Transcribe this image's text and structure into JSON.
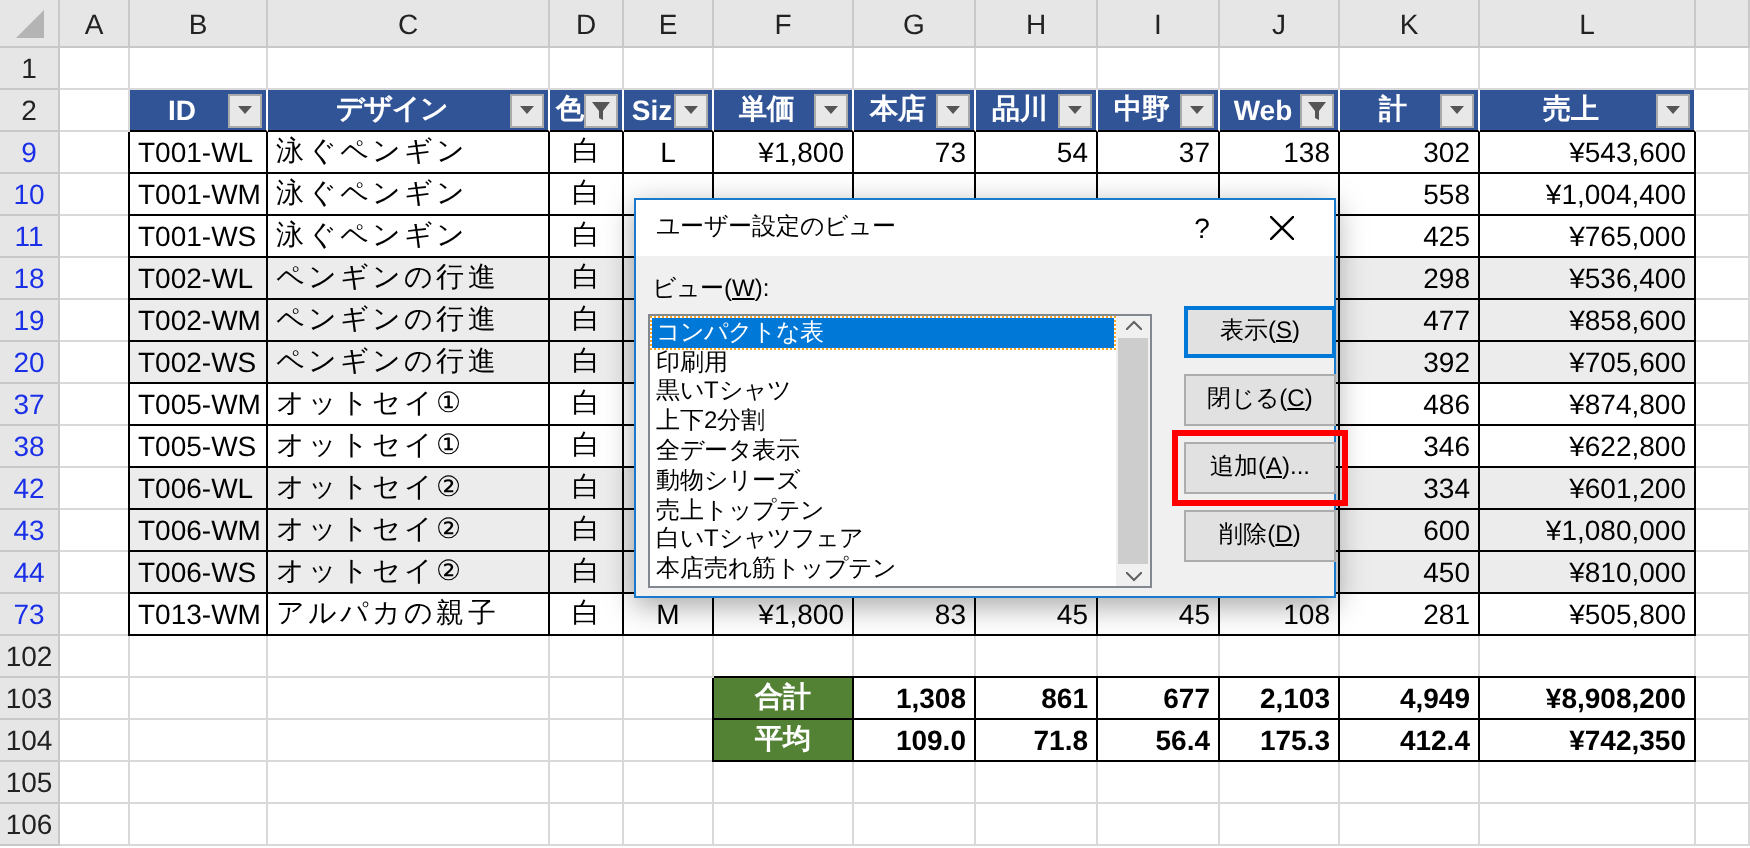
{
  "columns": [
    "A",
    "B",
    "C",
    "D",
    "E",
    "F",
    "G",
    "H",
    "I",
    "J",
    "K",
    "L"
  ],
  "rows": [
    {
      "num": "1",
      "kind": "blank",
      "filtered": false
    },
    {
      "num": "2",
      "kind": "header",
      "filtered": false,
      "headers": [
        {
          "label": "ID",
          "filtered": false
        },
        {
          "label": "デザイン",
          "filtered": false
        },
        {
          "label": "色",
          "filtered": true
        },
        {
          "label": "Siz",
          "filtered": false
        },
        {
          "label": "単価",
          "filtered": false
        },
        {
          "label": "本店",
          "filtered": false
        },
        {
          "label": "品川",
          "filtered": false
        },
        {
          "label": "中野",
          "filtered": false
        },
        {
          "label": "Web",
          "filtered": true
        },
        {
          "label": "計",
          "filtered": false
        },
        {
          "label": "売上",
          "filtered": false
        }
      ]
    },
    {
      "num": "9",
      "kind": "data",
      "filtered": true,
      "shaded": false,
      "cells": [
        "T001-WL",
        "泳ぐペンギン",
        "白",
        "L",
        "¥1,800",
        "73",
        "54",
        "37",
        "138",
        "302",
        "¥543,600"
      ]
    },
    {
      "num": "10",
      "kind": "data",
      "filtered": true,
      "shaded": false,
      "cells": [
        "T001-WM",
        "泳ぐペンギン",
        "白",
        null,
        null,
        null,
        null,
        null,
        null,
        "558",
        "¥1,004,400"
      ]
    },
    {
      "num": "11",
      "kind": "data",
      "filtered": true,
      "shaded": false,
      "cells": [
        "T001-WS",
        "泳ぐペンギン",
        "白",
        null,
        null,
        null,
        null,
        null,
        null,
        "425",
        "¥765,000"
      ]
    },
    {
      "num": "18",
      "kind": "data",
      "filtered": true,
      "shaded": true,
      "cells": [
        "T002-WL",
        "ペンギンの行進",
        "白",
        null,
        null,
        null,
        null,
        null,
        null,
        "298",
        "¥536,400"
      ]
    },
    {
      "num": "19",
      "kind": "data",
      "filtered": true,
      "shaded": true,
      "cells": [
        "T002-WM",
        "ペンギンの行進",
        "白",
        null,
        null,
        null,
        null,
        null,
        null,
        "477",
        "¥858,600"
      ]
    },
    {
      "num": "20",
      "kind": "data",
      "filtered": true,
      "shaded": true,
      "cells": [
        "T002-WS",
        "ペンギンの行進",
        "白",
        null,
        null,
        null,
        null,
        null,
        null,
        "392",
        "¥705,600"
      ]
    },
    {
      "num": "37",
      "kind": "data",
      "filtered": true,
      "shaded": false,
      "cells": [
        "T005-WM",
        "オットセイ①",
        "白",
        null,
        null,
        null,
        null,
        null,
        null,
        "486",
        "¥874,800"
      ]
    },
    {
      "num": "38",
      "kind": "data",
      "filtered": true,
      "shaded": false,
      "cells": [
        "T005-WS",
        "オットセイ①",
        "白",
        null,
        null,
        null,
        null,
        null,
        null,
        "346",
        "¥622,800"
      ]
    },
    {
      "num": "42",
      "kind": "data",
      "filtered": true,
      "shaded": true,
      "cells": [
        "T006-WL",
        "オットセイ②",
        "白",
        null,
        null,
        null,
        null,
        null,
        null,
        "334",
        "¥601,200"
      ]
    },
    {
      "num": "43",
      "kind": "data",
      "filtered": true,
      "shaded": true,
      "cells": [
        "T006-WM",
        "オットセイ②",
        "白",
        null,
        null,
        null,
        null,
        null,
        null,
        "600",
        "¥1,080,000"
      ]
    },
    {
      "num": "44",
      "kind": "data",
      "filtered": true,
      "shaded": true,
      "cells": [
        "T006-WS",
        "オットセイ②",
        "白",
        null,
        null,
        null,
        null,
        null,
        null,
        "450",
        "¥810,000"
      ]
    },
    {
      "num": "73",
      "kind": "data",
      "filtered": true,
      "shaded": false,
      "cells": [
        "T013-WM",
        "アルパカの親子",
        "白",
        "M",
        "¥1,800",
        "83",
        "45",
        "45",
        "108",
        "281",
        "¥505,800"
      ]
    },
    {
      "num": "102",
      "kind": "blank",
      "filtered": false
    },
    {
      "num": "103",
      "kind": "total",
      "filtered": false,
      "label": "合計",
      "values": [
        "1,308",
        "861",
        "677",
        "2,103",
        "4,949",
        "¥8,908,200"
      ]
    },
    {
      "num": "104",
      "kind": "total",
      "filtered": false,
      "label": "平均",
      "values": [
        "109.0",
        "71.8",
        "56.4",
        "175.3",
        "412.4",
        "¥742,350"
      ]
    },
    {
      "num": "105",
      "kind": "blank",
      "filtered": false
    },
    {
      "num": "106",
      "kind": "blank",
      "filtered": false
    }
  ],
  "dialog": {
    "title": "ユーザー設定のビュー",
    "help": "?",
    "list_label": {
      "before": "ビュー(",
      "mnemonic": "W",
      "after": "):"
    },
    "views": [
      {
        "label": "コンパクトな表",
        "selected": true
      },
      {
        "label": "印刷用",
        "selected": false
      },
      {
        "label": "黒いTシャツ",
        "selected": false
      },
      {
        "label": "上下2分割",
        "selected": false
      },
      {
        "label": "全データ表示",
        "selected": false
      },
      {
        "label": "動物シリーズ",
        "selected": false
      },
      {
        "label": "売上トップテン",
        "selected": false
      },
      {
        "label": "白いTシャツフェア",
        "selected": false
      },
      {
        "label": "本店売れ筋トップテン",
        "selected": false
      }
    ],
    "buttons": [
      {
        "before": "表示(",
        "mnemonic": "S",
        "after": ")",
        "default": true,
        "highlighted": false
      },
      {
        "before": "閉じる(",
        "mnemonic": "C",
        "after": ")",
        "default": false,
        "highlighted": false
      },
      {
        "before": "追加(",
        "mnemonic": "A",
        "after": ")...",
        "default": false,
        "highlighted": true
      },
      {
        "before": "削除(",
        "mnemonic": "D",
        "after": ")",
        "default": false,
        "highlighted": false
      }
    ]
  }
}
